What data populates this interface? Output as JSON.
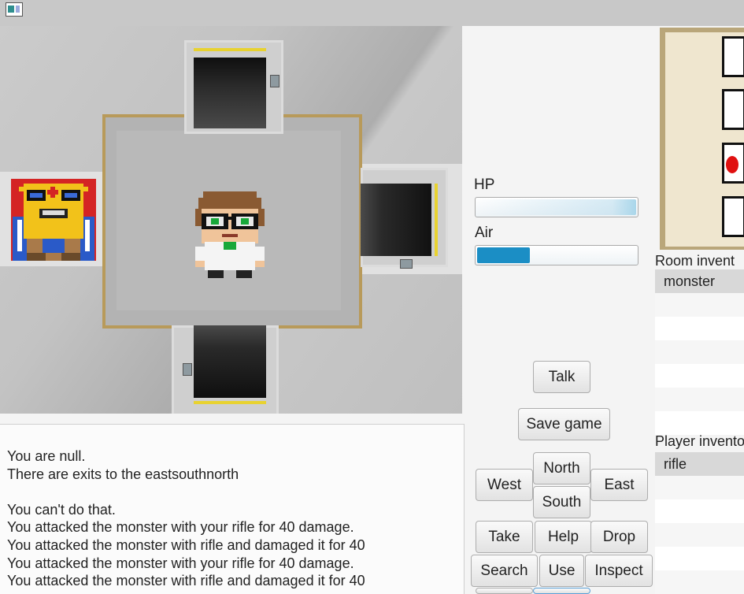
{
  "window": {
    "icon": "app-icon"
  },
  "status": {
    "hp_label": "HP",
    "hp_level": 1.0,
    "air_label": "Air",
    "air_level": 0.33
  },
  "buttons": {
    "talk": "Talk",
    "save": "Save game",
    "north": "North",
    "west": "West",
    "east": "East",
    "south": "South",
    "take": "Take",
    "help": "Help",
    "drop": "Drop",
    "search": "Search",
    "use": "Use",
    "inspect": "Inspect"
  },
  "log": {
    "lines": [
      "You are null.",
      "There are exits to the eastsouthnorth",
      "",
      "You can't do that.",
      "You attacked the monster with your rifle for 40 damage.",
      "You attacked the monster with rifle and damaged it for 40",
      "You attacked the monster with your rifle for 40 damage.",
      "You attacked the monster with rifle and damaged it for 40"
    ]
  },
  "room_inventory": {
    "title": "Room invent",
    "items": [
      "monster"
    ]
  },
  "player_inventory": {
    "title": "Player invento",
    "items": [
      "rifle"
    ]
  },
  "minimap": {
    "current_marker": "red-dot"
  },
  "colors": {
    "accent": "#1b8ec5",
    "door_light": "#e8d230",
    "room_border": "#b89a5a",
    "map_marker": "#e01010"
  }
}
